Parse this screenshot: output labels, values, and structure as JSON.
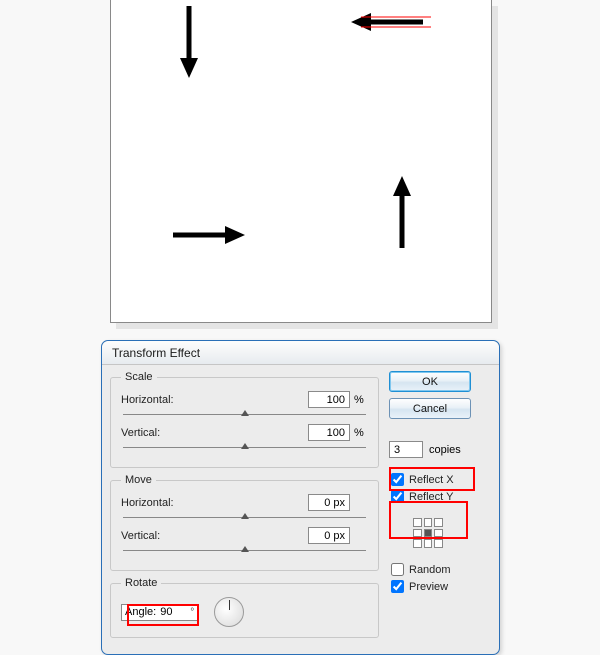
{
  "dialog": {
    "title": "Transform Effect",
    "scale": {
      "legend": "Scale",
      "horizontal_label": "Horizontal:",
      "horizontal_value": "100",
      "horizontal_unit": "%",
      "vertical_label": "Vertical:",
      "vertical_value": "100",
      "vertical_unit": "%"
    },
    "move": {
      "legend": "Move",
      "horizontal_label": "Horizontal:",
      "horizontal_value": "0 px",
      "vertical_label": "Vertical:",
      "vertical_value": "0 px"
    },
    "rotate": {
      "legend": "Rotate",
      "angle_label": "Angle:",
      "angle_value": "90",
      "degree_symbol": "°"
    },
    "buttons": {
      "ok": "OK",
      "cancel": "Cancel"
    },
    "copies": {
      "value": "3",
      "label": "copies"
    },
    "options": {
      "reflect_x": {
        "label": "Reflect X",
        "checked": true
      },
      "reflect_y": {
        "label": "Reflect Y",
        "checked": true
      },
      "random": {
        "label": "Random",
        "checked": false
      },
      "preview": {
        "label": "Preview",
        "checked": true
      }
    }
  },
  "canvas": {
    "arrows": [
      {
        "id": "arrow-down",
        "selected": false
      },
      {
        "id": "arrow-left",
        "selected": true
      },
      {
        "id": "arrow-right",
        "selected": false
      },
      {
        "id": "arrow-up",
        "selected": false
      }
    ]
  },
  "colors": {
    "highlight": "#ff0000",
    "selection": "#ff0000",
    "arrow": "#000000"
  }
}
